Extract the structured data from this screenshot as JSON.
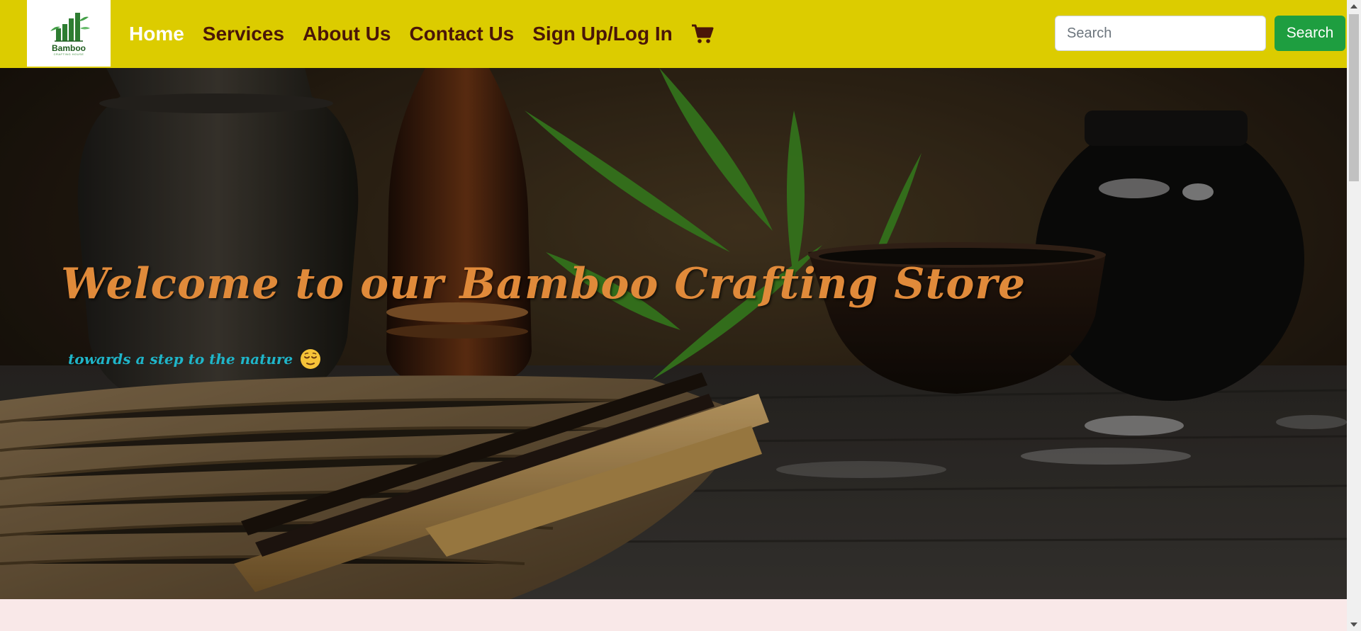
{
  "brand": {
    "name": "Bamboo",
    "tagline": "CRAFTING HOUSE",
    "colors": {
      "navbar": "#dccc00",
      "nav_text": "#4a1608",
      "active": "#ffffff",
      "search_button": "#1e9e40",
      "title": "#e08a3a",
      "subtitle": "#1fb5c9"
    }
  },
  "nav": {
    "items": [
      {
        "label": "Home",
        "active": true
      },
      {
        "label": "Services",
        "active": false
      },
      {
        "label": "About Us",
        "active": false
      },
      {
        "label": "Contact Us",
        "active": false
      },
      {
        "label": "Sign Up/Log In",
        "active": false
      }
    ],
    "cart_icon": "shopping-cart-icon"
  },
  "search": {
    "placeholder": "Search",
    "value": "",
    "button_label": "Search"
  },
  "hero": {
    "title": "Welcome to our Bamboo Crafting Store",
    "subtitle": "towards a step to the nature",
    "emoji": "relieved-face-emoji"
  }
}
